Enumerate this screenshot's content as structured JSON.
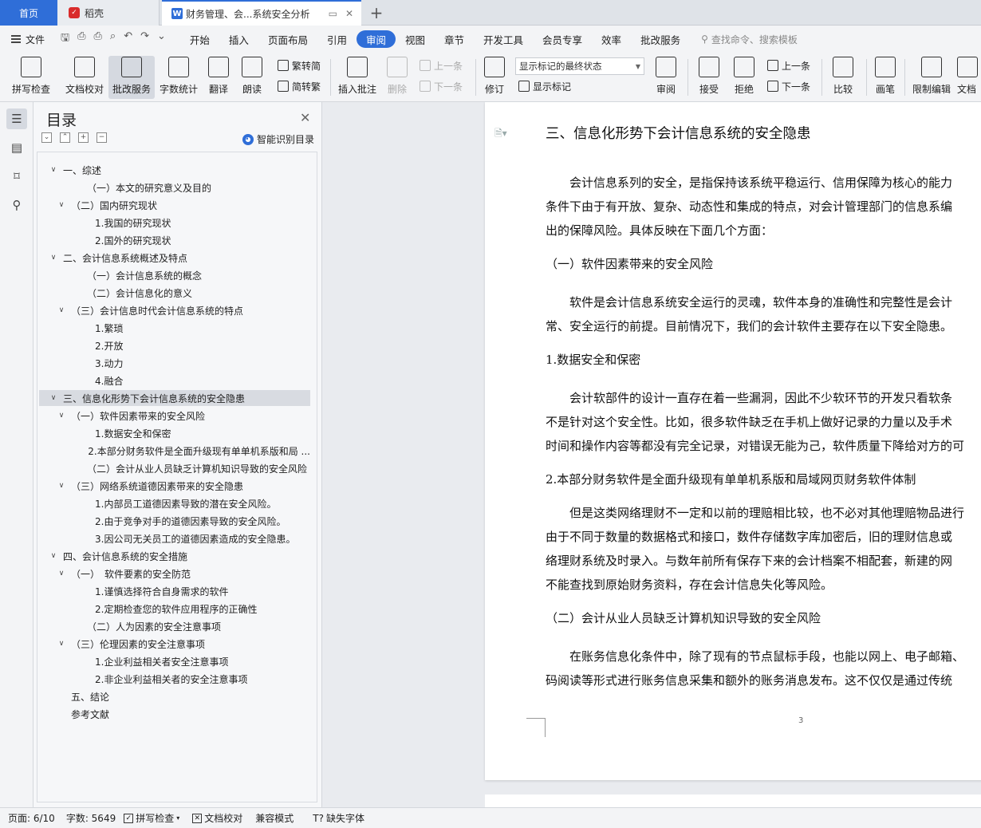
{
  "tabs": {
    "home": "首页",
    "daoke": "稻壳",
    "doc": "财务管理、会...系统安全分析"
  },
  "menu": {
    "file": "文件",
    "tabs": [
      "开始",
      "插入",
      "页面布局",
      "引用",
      "审阅",
      "视图",
      "章节",
      "开发工具",
      "会员专享",
      "效率",
      "批改服务"
    ],
    "active_tab": "审阅",
    "search": "查找命令、搜索模板"
  },
  "ribbon": {
    "spell": "拼写检查",
    "proof": "文档校对",
    "correct": "批改服务",
    "wordcount": "字数统计",
    "translate": "翻译",
    "read": "朗读",
    "trad": "繁转简",
    "simp": "简转繁",
    "insert_comment": "插入批注",
    "delete": "删除",
    "prev": "上一条",
    "next": "下一条",
    "revise": "修订",
    "markup_select": "显示标记的最终状态",
    "show_markup": "显示标记",
    "review": "审阅",
    "accept": "接受",
    "reject": "拒绝",
    "prev2": "上一条",
    "next2": "下一条",
    "compare": "比较",
    "pen": "画笔",
    "restrict": "限制编辑",
    "doc_more": "文档"
  },
  "toc": {
    "title": "目录",
    "smart": "智能识别目录",
    "items": [
      {
        "text": "一、综述",
        "chev": "∨"
      },
      {
        "text": "（一）本文的研究意义及目的",
        "chev": ""
      },
      {
        "text": "（二）国内研究现状",
        "chev": "∨"
      },
      {
        "text": "1.我国的研究现状",
        "chev": ""
      },
      {
        "text": "2.国外的研究现状",
        "chev": ""
      },
      {
        "text": "二、会计信息系统概述及特点",
        "chev": "∨"
      },
      {
        "text": "（一）会计信息系统的概念",
        "chev": ""
      },
      {
        "text": "（二）会计信息化的意义",
        "chev": ""
      },
      {
        "text": "（三）会计信息时代会计信息系统的特点",
        "chev": "∨"
      },
      {
        "text": "1.繁琐",
        "chev": ""
      },
      {
        "text": "2.开放",
        "chev": ""
      },
      {
        "text": "3.动力",
        "chev": ""
      },
      {
        "text": "4.融合",
        "chev": ""
      },
      {
        "text": "三、信息化形势下会计信息系统的安全隐患",
        "chev": "∨"
      },
      {
        "text": "（一）软件因素带来的安全风险",
        "chev": "∨"
      },
      {
        "text": "1.数据安全和保密",
        "chev": ""
      },
      {
        "text": "2.本部分财务软件是全面升级现有单单机系版和局 ...",
        "chev": ""
      },
      {
        "text": "（二）会计从业人员缺乏计算机知识导致的安全风险",
        "chev": ""
      },
      {
        "text": "（三）网络系统道德因素带来的安全隐患",
        "chev": "∨"
      },
      {
        "text": "1.内部员工道德因素导致的潜在安全风险。",
        "chev": ""
      },
      {
        "text": "2.由于竞争对手的道德因素导致的安全风险。",
        "chev": ""
      },
      {
        "text": "3.因公司无关员工的道德因素造成的安全隐患。",
        "chev": ""
      },
      {
        "text": "四、会计信息系统的安全措施",
        "chev": "∨"
      },
      {
        "text": "（一）　软件要素的安全防范",
        "chev": "∨"
      },
      {
        "text": "1.谨慎选择符合自身需求的软件",
        "chev": ""
      },
      {
        "text": "2.定期检查您的软件应用程序的正确性",
        "chev": ""
      },
      {
        "text": "（二）人为因素的安全注意事项",
        "chev": ""
      },
      {
        "text": "（三）伦理因素的安全注意事项",
        "chev": "∨"
      },
      {
        "text": "1.企业利益相关者安全注意事项",
        "chev": ""
      },
      {
        "text": "2.非企业利益相关者的安全注意事项",
        "chev": ""
      },
      {
        "text": "五、结论",
        "chev": ""
      },
      {
        "text": "参考文献",
        "chev": ""
      }
    ]
  },
  "doc": {
    "heading": "三、信息化形势下会计信息系统的安全隐患",
    "lines": [
      "会计信息系列的安全，是指保持该系统平稳运行、信用保障为核心的能力",
      "条件下由于有开放、复杂、动态性和集成的特点，对会计管理部门的信息系编",
      "出的保障风险。具体反映在下面几个方面：",
      "（一）软件因素带来的安全风险",
      "软件是会计信息系统安全运行的灵魂，软件本身的准确性和完整性是会计",
      "常、安全运行的前提。目前情况下，我们的会计软件主要存在以下安全隐患。",
      "1.数据安全和保密",
      "会计软部件的设计一直存在着一些漏洞，因此不少软环节的开发只看软条",
      "不是针对这个安全性。比如，很多软件缺乏在手机上做好记录的力量以及手术",
      "时间和操作内容等都没有完全记录，对错误无能为己，软件质量下降给对方的可",
      "2.本部分财务软件是全面升级现有单单机系版和局域网页财务软件体制",
      "但是这类网络理财不一定和以前的理赔相比较，也不必对其他理赔物品进行",
      "由于不同于数量的数据格式和接口，数件存储数字库加密后，旧的理财信息或",
      "络理财系统及时录入。与数年前所有保存下来的会计档案不相配套，新建的网",
      "不能查找到原始财务资料，存在会计信息失化等风险。",
      "（二）会计从业人员缺乏计算机知识导致的安全风险",
      "在账务信息化条件中，除了现有的节点鼠标手段，也能以网上、电子邮箱、",
      "码阅读等形式进行账务信息采集和额外的账务消息发布。这不仅仅是通过传统"
    ],
    "page_number": "3"
  },
  "status": {
    "page": "页面: 6/10",
    "words": "字数: 5649",
    "spell": "拼写检查",
    "proof": "文档校对",
    "compat": "兼容模式",
    "missing_font": "缺失字体"
  }
}
